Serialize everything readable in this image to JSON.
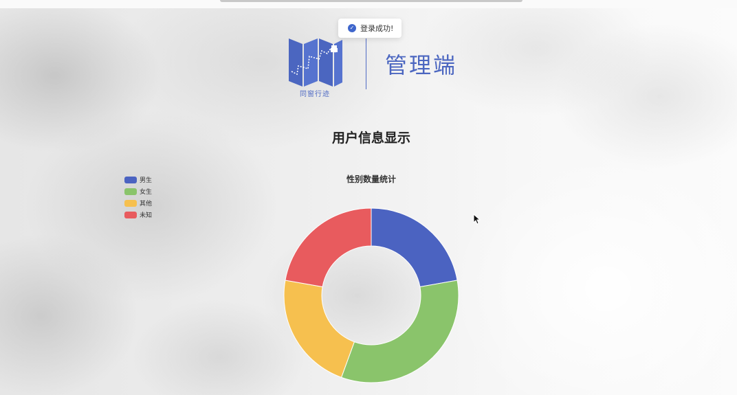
{
  "toast": {
    "icon": "check-circle-icon",
    "message": "登录成功!"
  },
  "header": {
    "logo_caption": "同窗行迹",
    "title": "管理端"
  },
  "page": {
    "title": "用户信息显示"
  },
  "chart_data": {
    "type": "pie",
    "variant": "donut",
    "title": "性别数量统计",
    "legend_position": "top-left",
    "categories": [
      "男生",
      "女生",
      "其他",
      "未知"
    ],
    "values": [
      2,
      3,
      2,
      2
    ],
    "colors": [
      "#4b63c1",
      "#8ac46b",
      "#f6c04f",
      "#e85b5e"
    ]
  },
  "colors": {
    "accent": "#4b66c0"
  }
}
